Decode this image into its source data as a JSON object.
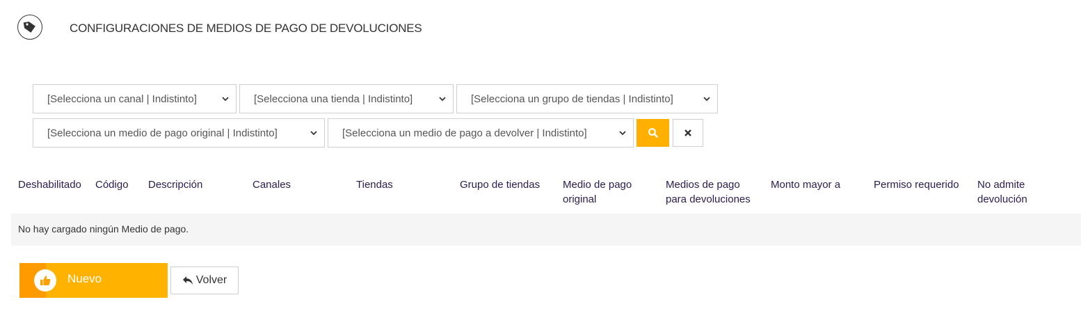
{
  "header": {
    "title": "CONFIGURACIONES DE MEDIOS DE PAGO DE DEVOLUCIONES",
    "icon": "tag-icon"
  },
  "filters": {
    "channel": "[Selecciona un canal | Indistinto]",
    "store": "[Selecciona una tienda | Indistinto]",
    "store_group": "[Selecciona un grupo de tiendas | Indistinto]",
    "original_payment": "[Selecciona un medio de pago original | Indistinto]",
    "refund_payment": "[Selecciona un medio de pago a devolver | Indistinto]",
    "search_icon": "search-icon",
    "clear_icon": "close-icon"
  },
  "table": {
    "columns": [
      "Deshabilitado",
      "Código",
      "Descripción",
      "Canales",
      "Tiendas",
      "Grupo de tiendas",
      [
        "Medio de pago",
        "original"
      ],
      [
        "Medios de pago",
        "para devoluciones"
      ],
      "Monto mayor a",
      "Permiso requerido",
      [
        "No admite",
        "devolución"
      ]
    ],
    "empty_message": "No hay cargado ningún Medio de pago."
  },
  "actions": {
    "new_label": "Nuevo",
    "back_label": "Volver"
  },
  "colors": {
    "accent": "#ffb300",
    "accent_dark": "#ff9a00",
    "header_text": "#2a1c4f"
  }
}
